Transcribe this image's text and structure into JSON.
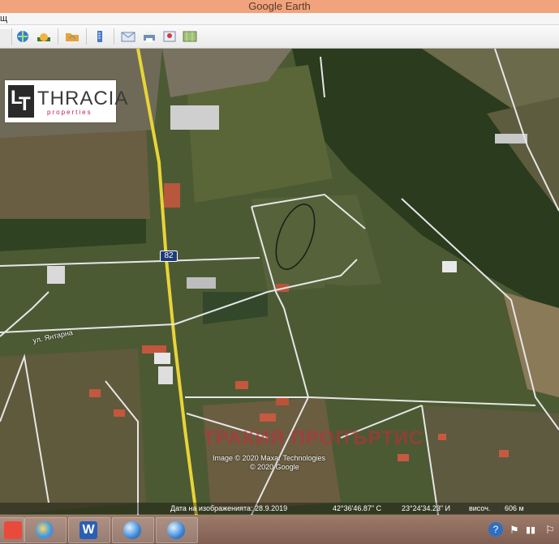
{
  "window": {
    "title": "Google Earth"
  },
  "menubar": {
    "fragment": "щ"
  },
  "toolbar": {
    "buttons": [
      "sidebar-button",
      "layers-button",
      "sunlight-button",
      "folder-button",
      "ruler-button",
      "email-button",
      "print-button",
      "save-image-button",
      "view-in-maps-button"
    ]
  },
  "logo": {
    "name": "THRACIA",
    "sub": "properties"
  },
  "map": {
    "road_number": "82",
    "street_name": "ул. Янтарна",
    "watermark": "ТРАКИЯ ПРОПЪРТИС",
    "copyright_line1": "Image © 2020 Maxar Technologies",
    "copyright_line2": "© 2020 Google",
    "status": {
      "image_date": "Дата на изображенията: 28.9.2019",
      "lat": "42°36'46.87\" С",
      "lon": "23°24'34.23\" И",
      "altitude_label": "височ.",
      "altitude_value": "606 м"
    }
  },
  "taskbar": {
    "apps": [
      "paint-app",
      "paint-app-2",
      "word-app",
      "google-earth-app",
      "google-earth-app-2"
    ],
    "tray": [
      "help-icon",
      "flag-icon",
      "network-icon"
    ]
  },
  "colors": {
    "titlebar": "#f0a37c",
    "road_yellow": "#e8d437",
    "road_white": "#e6e6e6",
    "taskbar": "#8f6c5d"
  }
}
